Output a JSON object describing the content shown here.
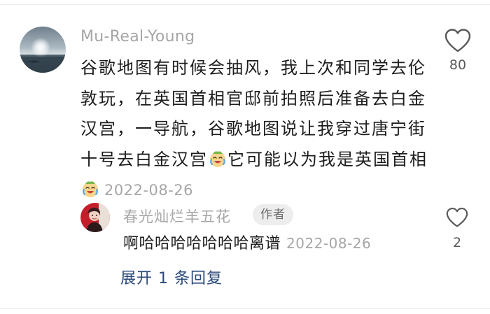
{
  "comment": {
    "username": "Mu-Real-Young",
    "text_parts": [
      "谷歌地图有时候会抽风，我上次和同学去伦敦玩，在英国首相官邸前拍照后准备去白金汉宫，一导航，谷歌地图说让我穿过唐宁街十号去白金汉宫",
      "它可能以为我是英国首相"
    ],
    "emoji": "crying-laughing-face-icon",
    "timestamp": "2022-08-26",
    "like_count": "80"
  },
  "reply": {
    "username": "春光灿烂羊五花",
    "badge": "作者",
    "text": "啊哈哈哈哈哈哈哈离谱",
    "timestamp": "2022-08-26",
    "like_count": "2"
  },
  "expand": {
    "label": "展开 1 条回复"
  },
  "colors": {
    "primary_text": "#1d1d1d",
    "secondary_text": "#a6a6a6",
    "link": "#2b4a7a",
    "badge_bg": "#ededed"
  }
}
